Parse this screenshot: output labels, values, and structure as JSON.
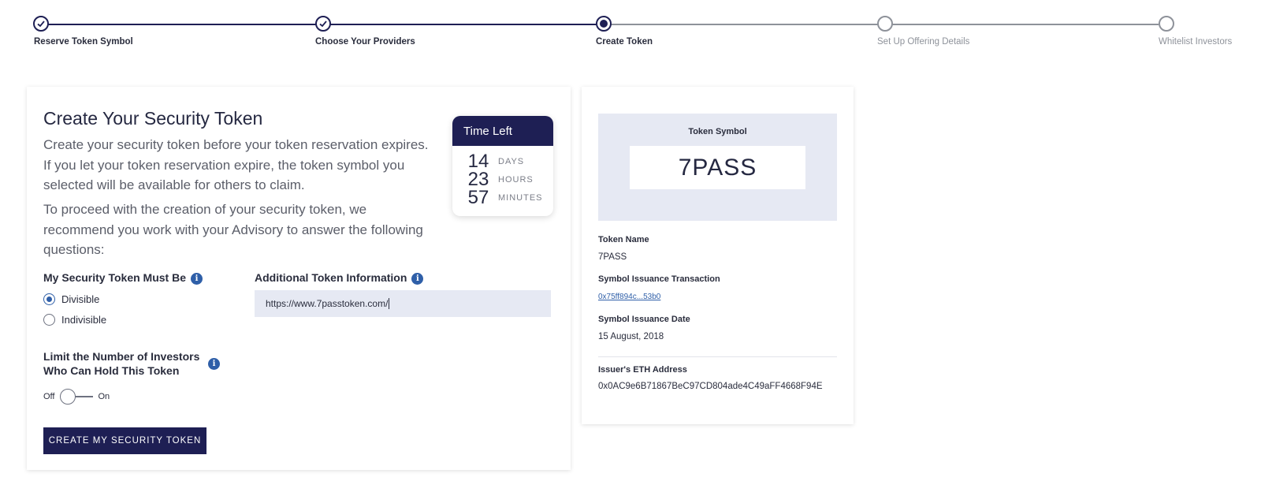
{
  "stepper": {
    "steps": [
      {
        "label": "Reserve Token Symbol",
        "state": "done"
      },
      {
        "label": "Choose Your Providers",
        "state": "done"
      },
      {
        "label": "Create Token",
        "state": "active"
      },
      {
        "label": "Set Up Offering Details",
        "state": "todo"
      },
      {
        "label": "Whitelist Investors",
        "state": "todo"
      }
    ]
  },
  "main": {
    "title": "Create Your Security Token",
    "paragraph1": "Create your security token before your token reservation expires. If you let your token reservation expire, the token symbol you selected will be available for others to claim.",
    "paragraph2": "To proceed with the creation of your security token, we recommend you work with your Advisory to answer the following questions:",
    "timer": {
      "title": "Time Left",
      "days": "14",
      "days_label": "DAYS",
      "hours": "23",
      "hours_label": "HOURS",
      "minutes": "57",
      "minutes_label": "MINUTES"
    },
    "divisibility": {
      "label": "My Security Token Must Be",
      "options": [
        "Divisible",
        "Indivisible"
      ],
      "selected": "Divisible"
    },
    "additional_info": {
      "label": "Additional Token Information",
      "value": "https://www.7passtoken.com/"
    },
    "limit_investors": {
      "label": "Limit the Number of Investors Who Can Hold This Token",
      "off_label": "Off",
      "on_label": "On",
      "enabled": false
    },
    "create_button": "CREATE MY SECURITY TOKEN"
  },
  "side": {
    "symbol_caption": "Token Symbol",
    "symbol": "7PASS",
    "token_name_label": "Token Name",
    "token_name": "7PASS",
    "tx_label": "Symbol Issuance Transaction",
    "tx_value": "0x75ff894c...53b0",
    "date_label": "Symbol Issuance Date",
    "date_value": "15 August, 2018",
    "eth_label": "Issuer's ETH Address",
    "eth_value": "0x0AC9e6B71867BeC97CD804ade4C49aFF4668F94E"
  },
  "colors": {
    "primary": "#1e1f54",
    "accent": "#2f5fa8",
    "input_bg": "#e6e9f3",
    "muted": "#8e929a"
  }
}
